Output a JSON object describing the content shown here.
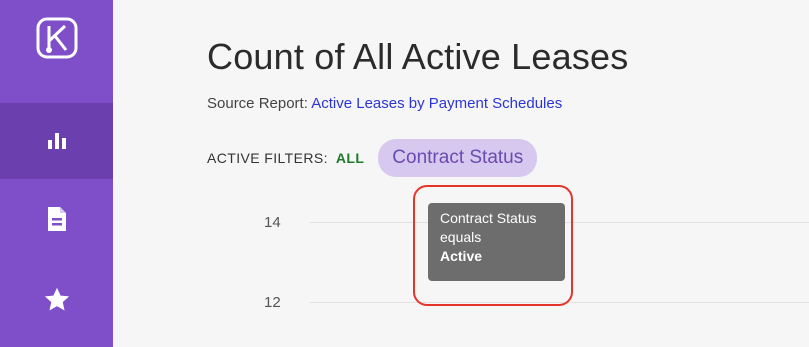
{
  "sidebar": {
    "items": [
      {
        "name": "logo",
        "icon": "logo-icon"
      },
      {
        "name": "reports",
        "icon": "bar-chart-icon",
        "active": true
      },
      {
        "name": "documents",
        "icon": "document-icon"
      },
      {
        "name": "favorites",
        "icon": "star-icon"
      }
    ]
  },
  "header": {
    "title": "Count of All Active Leases",
    "source_label": "Source Report:",
    "source_link": "Active Leases by Payment Schedules"
  },
  "filters": {
    "label": "ACTIVE FILTERS:",
    "all_label": "ALL",
    "chip_label": "Contract Status"
  },
  "chart": {
    "y_ticks": [
      "14",
      "12"
    ]
  },
  "tooltip": {
    "line1": "Contract Status",
    "line2": "equals",
    "line3": "Active"
  },
  "colors": {
    "sidebar": "#7f4fc9",
    "sidebar_active": "#6b3fae",
    "chip_bg": "#d7c8f0",
    "chip_text": "#6a4bb0",
    "link": "#2b35d6",
    "all_green": "#1f7a2a",
    "highlight": "#e5352a"
  }
}
